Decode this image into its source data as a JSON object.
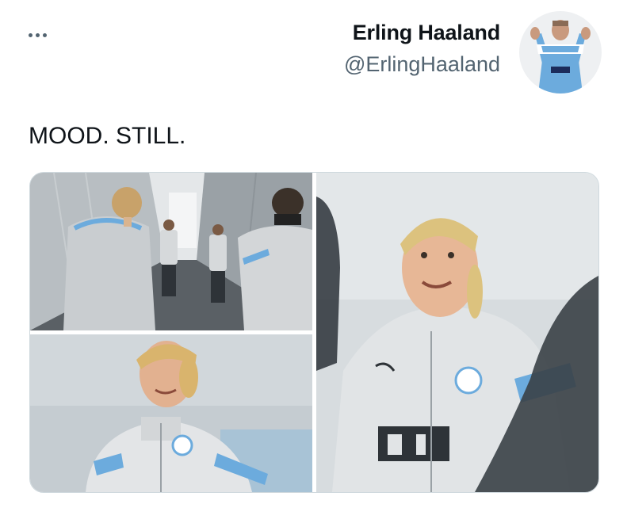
{
  "tweet": {
    "author": {
      "display_name": "Erling Haaland",
      "handle": "@ErlingHaaland",
      "avatar_icon": "profile-avatar"
    },
    "more_icon": "more-horizontal-icon",
    "text": "MOOD. STILL.",
    "media": [
      {
        "kind": "photo",
        "subject": "players walking down tunnel"
      },
      {
        "kind": "photo",
        "subject": "player smiling in training top"
      },
      {
        "kind": "photo",
        "subject": "player close-up in training top"
      }
    ]
  },
  "colors": {
    "text_primary": "#0f1419",
    "text_secondary": "#536471",
    "border": "#cfd9de",
    "city_blue": "#6cabdd",
    "kit_grey": "#dcdfe1"
  }
}
